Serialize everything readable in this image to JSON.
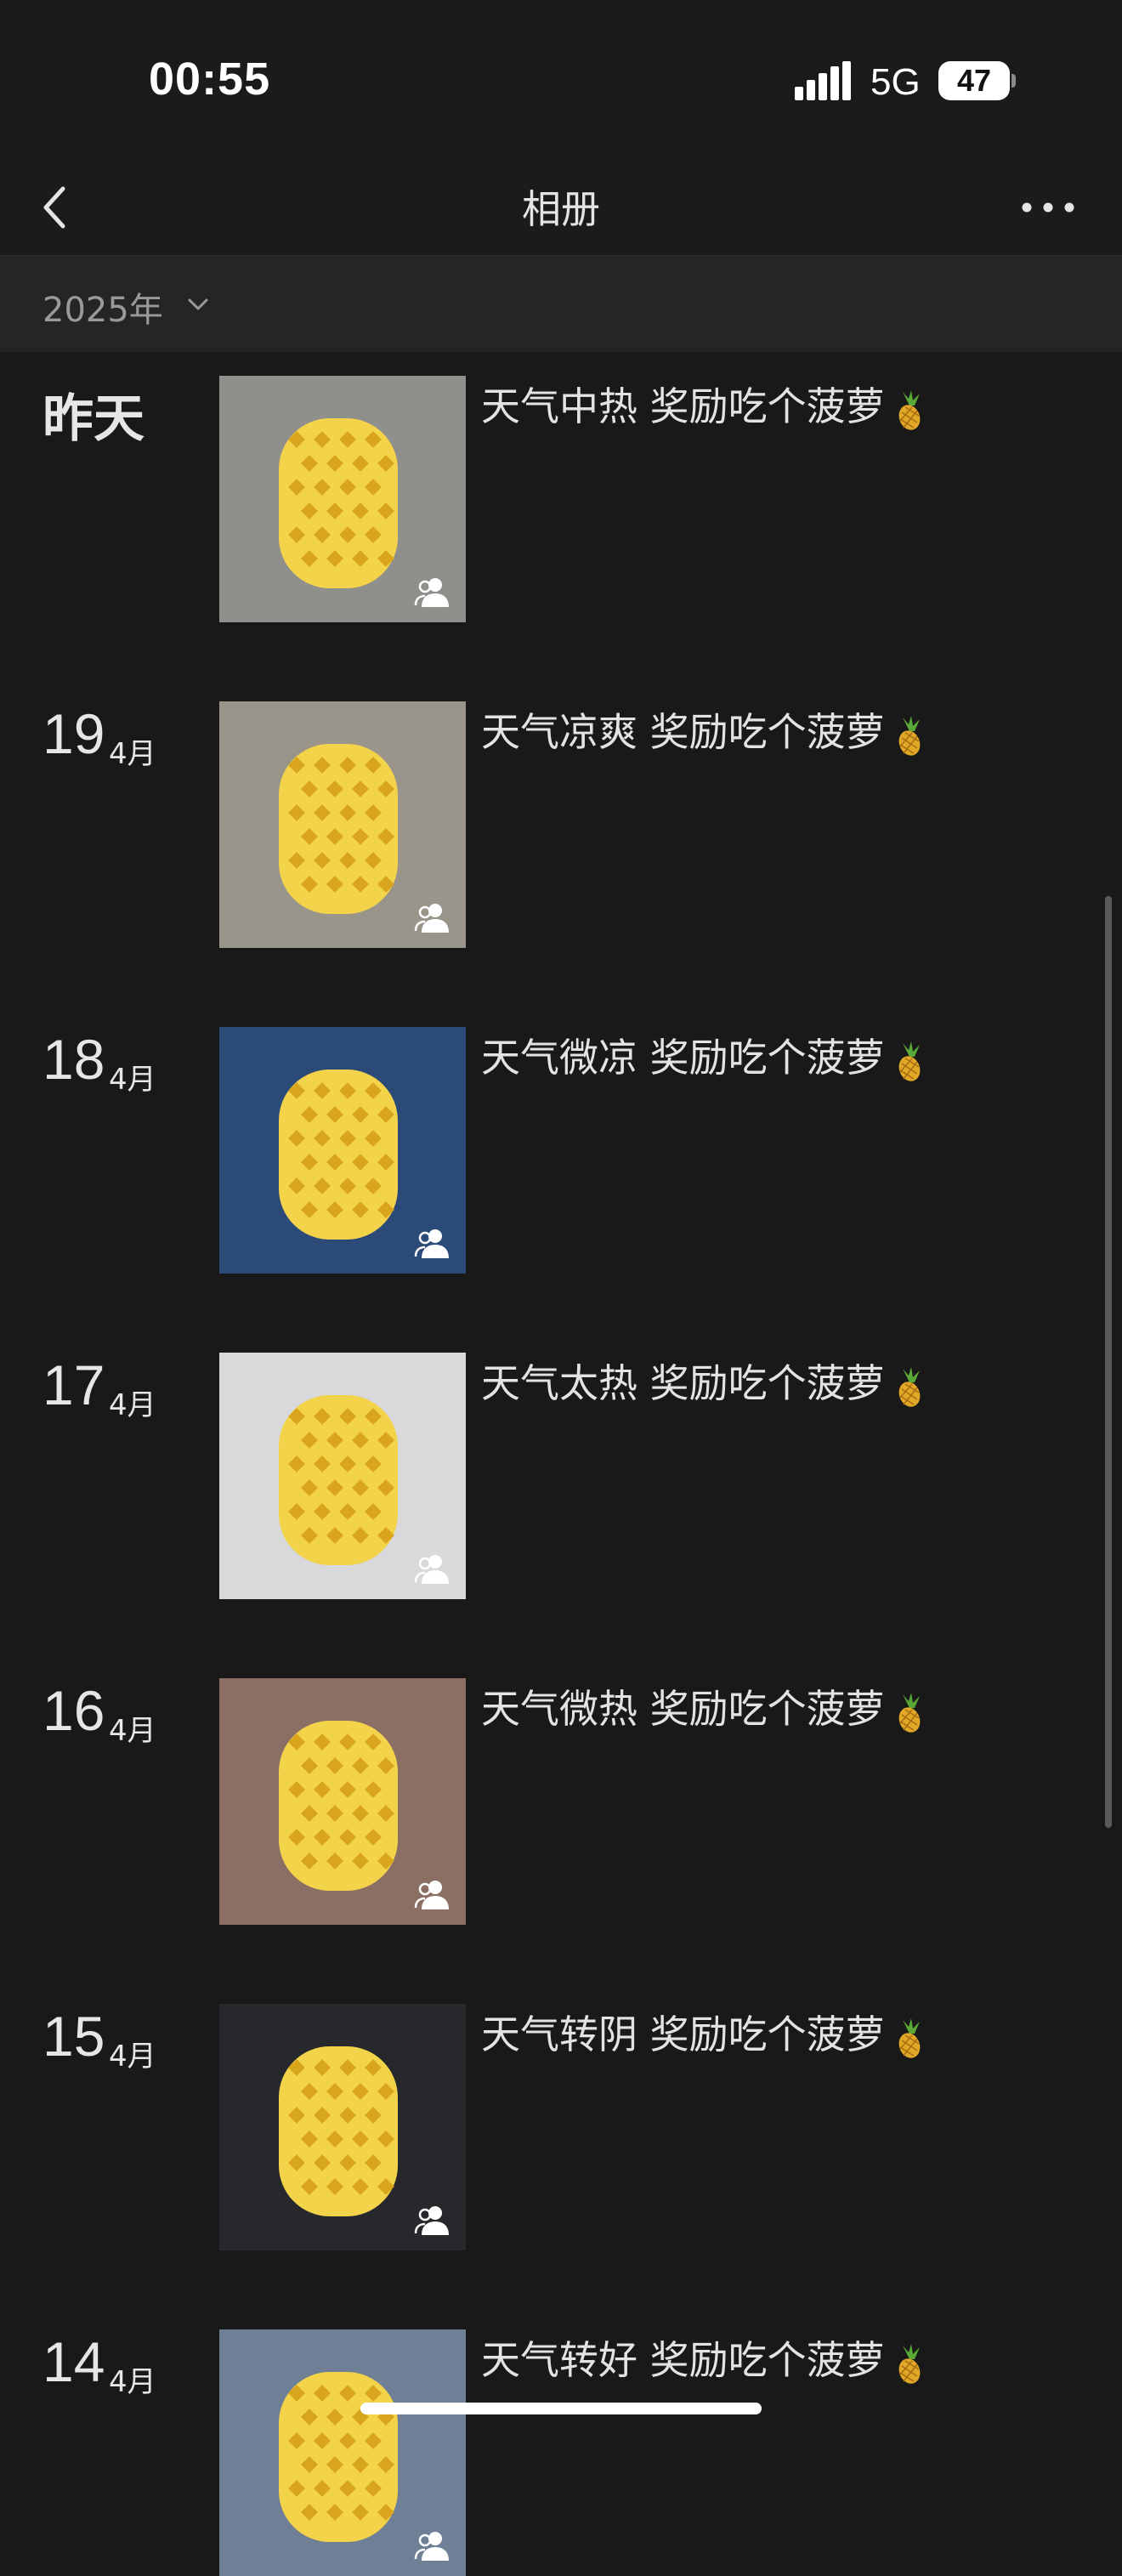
{
  "status_bar": {
    "time": "00:55",
    "network": "5G",
    "battery": "47"
  },
  "nav": {
    "title": "相册",
    "back_icon": "chevron-left-icon",
    "more_icon": "more-dots-icon"
  },
  "year_selector": {
    "label": "2025年",
    "icon": "chevron-down-icon"
  },
  "posts": [
    {
      "day": "",
      "month": "",
      "day_label": "昨天",
      "caption": "天气中热 奖励吃个菠萝",
      "emoji": "pineapple",
      "bg": "#8f8f8c"
    },
    {
      "day": "19",
      "month": "4月",
      "day_label": "",
      "caption": "天气凉爽 奖励吃个菠萝",
      "emoji": "pineapple",
      "bg": "#9a958a"
    },
    {
      "day": "18",
      "month": "4月",
      "day_label": "",
      "caption": "天气微凉 奖励吃个菠萝",
      "emoji": "pineapple",
      "bg": "#2c4a78"
    },
    {
      "day": "17",
      "month": "4月",
      "day_label": "",
      "caption": "天气太热 奖励吃个菠萝",
      "emoji": "pineapple",
      "bg": "#d9d9dc"
    },
    {
      "day": "16",
      "month": "4月",
      "day_label": "",
      "caption": "天气微热 奖励吃个菠萝",
      "emoji": "pineapple",
      "bg": "#8c6f64"
    },
    {
      "day": "15",
      "month": "4月",
      "day_label": "",
      "caption": "天气转阴 奖励吃个菠萝",
      "emoji": "pineapple",
      "bg": "#26282c"
    },
    {
      "day": "14",
      "month": "4月",
      "day_label": "",
      "caption": "天气转好 奖励吃个菠萝",
      "emoji": "pineapple",
      "bg": "#6f7f95"
    }
  ],
  "colors": {
    "background": "#191919",
    "header": "#1b1b1c",
    "year_bar": "#252525",
    "pineapple": "#f3d34a"
  }
}
